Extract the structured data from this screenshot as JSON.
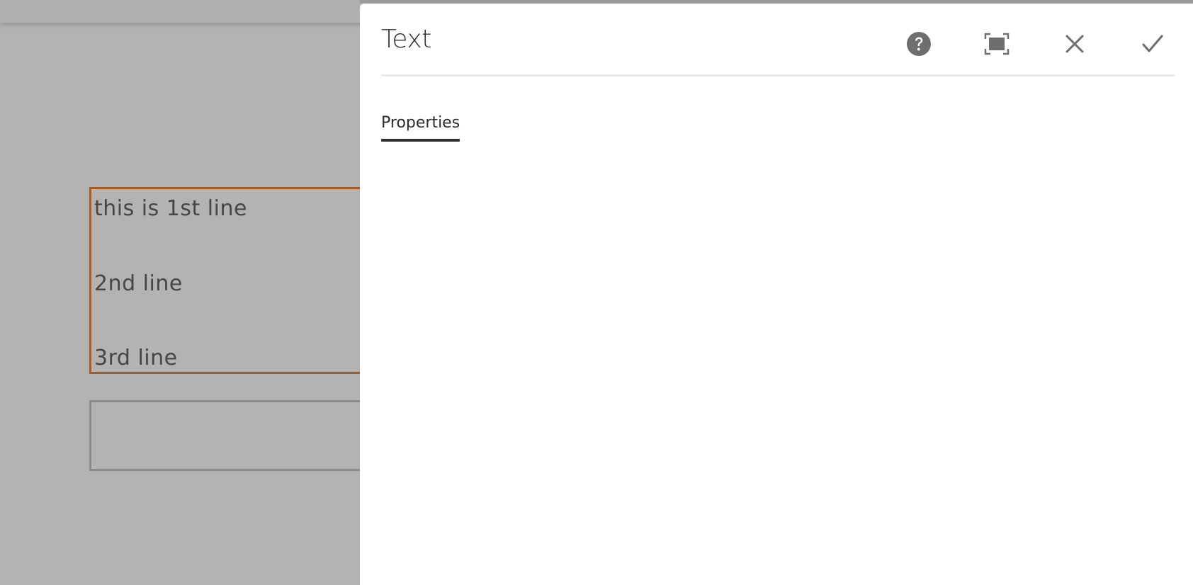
{
  "editor": {
    "component_lines": [
      "this is 1st line",
      "2nd line",
      "3rd line"
    ]
  },
  "dialog": {
    "title": "Text",
    "tabs": [
      {
        "label": "Properties",
        "active": true
      }
    ],
    "actions": [
      {
        "name": "help",
        "icon": "help-icon"
      },
      {
        "name": "fullscreen",
        "icon": "fullscreen-icon"
      },
      {
        "name": "cancel",
        "icon": "close-icon"
      },
      {
        "name": "done",
        "icon": "checkmark-icon"
      }
    ]
  },
  "colors": {
    "overlay_gray": "#b3b3b3",
    "selection_border": "#a15b25",
    "icon_gray": "#6e6e6e",
    "text_dark": "#323232"
  }
}
